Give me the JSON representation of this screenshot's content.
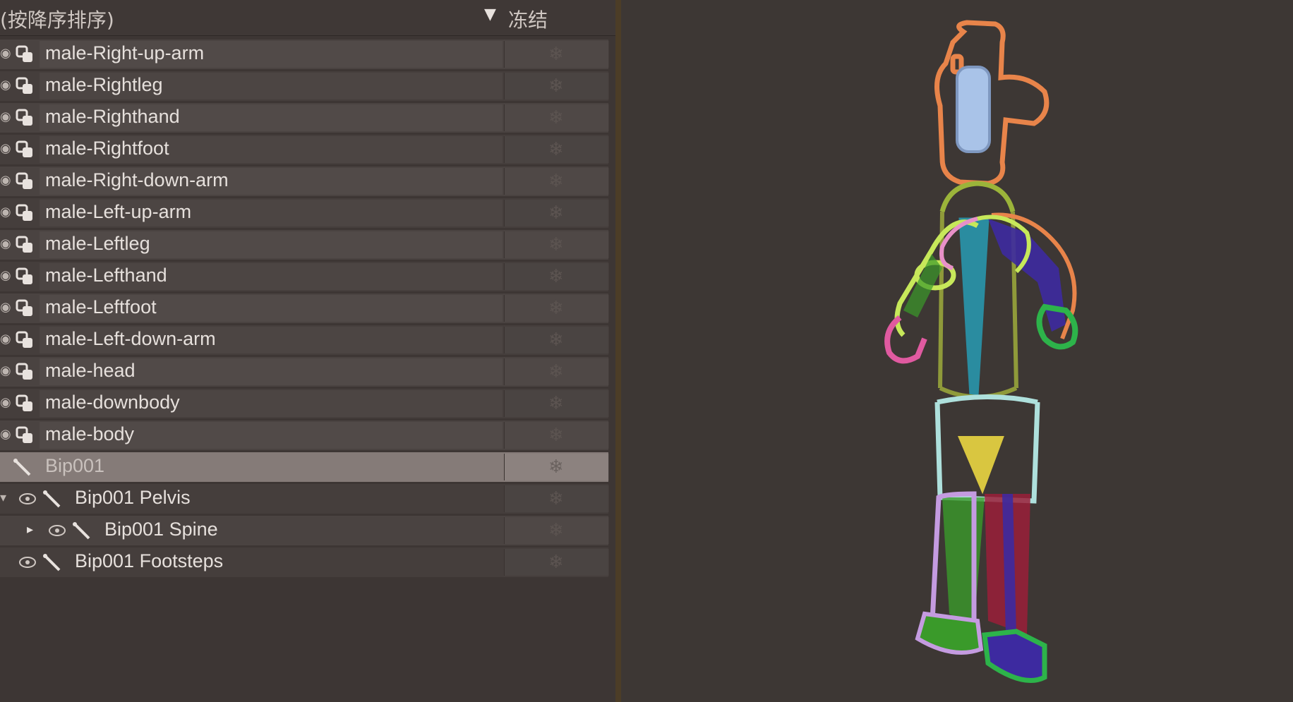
{
  "header": {
    "sort_label": "(按降序排序)",
    "sort_arrow": "▼",
    "freeze_column": "冻结"
  },
  "icons": {
    "expand_collapsed": "▸",
    "expand_open": "▾",
    "freeze": "❄"
  },
  "rows": [
    {
      "label": "male-Right-up-arm"
    },
    {
      "label": "male-Rightleg"
    },
    {
      "label": "male-Righthand"
    },
    {
      "label": "male-Rightfoot"
    },
    {
      "label": "male-Right-down-arm"
    },
    {
      "label": "male-Left-up-arm"
    },
    {
      "label": "male-Leftleg"
    },
    {
      "label": "male-Lefthand"
    },
    {
      "label": "male-Leftfoot"
    },
    {
      "label": "male-Left-down-arm"
    },
    {
      "label": "male-head"
    },
    {
      "label": "male-downbody"
    },
    {
      "label": "male-body"
    },
    {
      "label": "Bip001"
    },
    {
      "label": "Bip001 Pelvis"
    },
    {
      "label": "Bip001 Spine"
    },
    {
      "label": "Bip001 Footsteps"
    }
  ],
  "colors": {
    "panel_bg": "#3d3634",
    "viewport_bg": "#3d3734",
    "selected_row": "#857b78",
    "head": "#e8844a",
    "face": "#a9c3e8",
    "neck": "#9bb43a",
    "spine": "#2a8ca0",
    "left_arm": "#c7e85a",
    "left_hand": "#e05aa0",
    "right_arm": "#3d2aa0",
    "right_hand": "#2db34a",
    "pelvis": "#d9c640",
    "hips": "#aee0dc",
    "left_leg": "#c49be0",
    "right_leg": "#9a1f3a",
    "leg_green": "#3a9a2a"
  }
}
